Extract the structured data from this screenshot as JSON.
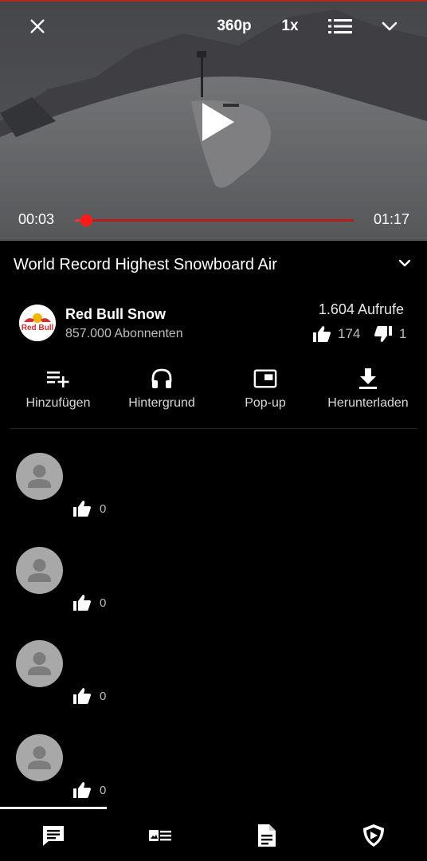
{
  "player": {
    "quality": "360p",
    "speed": "1x",
    "current_time": "00:03",
    "total_time": "01:17",
    "progress_fraction": 0.04
  },
  "video": {
    "title": "World Record Highest Snowboard Air"
  },
  "channel": {
    "name": "Red Bull Snow",
    "subscribers": "857.000 Abonnenten",
    "logo_text": "Red Bull"
  },
  "stats": {
    "views": "1.604 Aufrufe",
    "likes": "174",
    "dislikes": "1"
  },
  "actions": [
    {
      "label": "Hinzufügen",
      "icon": "playlist-add-icon"
    },
    {
      "label": "Hintergrund",
      "icon": "headphones-icon"
    },
    {
      "label": "Pop-up",
      "icon": "picture-in-picture-icon"
    },
    {
      "label": "Herunterladen",
      "icon": "download-icon"
    }
  ],
  "comments": [
    {
      "likes": "0"
    },
    {
      "likes": "0"
    },
    {
      "likes": "0"
    },
    {
      "likes": "0"
    }
  ],
  "bottom_nav": [
    {
      "icon": "comments-icon",
      "active": true
    },
    {
      "icon": "related-videos-icon",
      "active": false
    },
    {
      "icon": "description-icon",
      "active": false
    },
    {
      "icon": "sponsorblock-icon",
      "active": false
    }
  ],
  "colors": {
    "accent": "#e53935",
    "background": "#000000",
    "secondary_text": "#bdbdbd"
  }
}
